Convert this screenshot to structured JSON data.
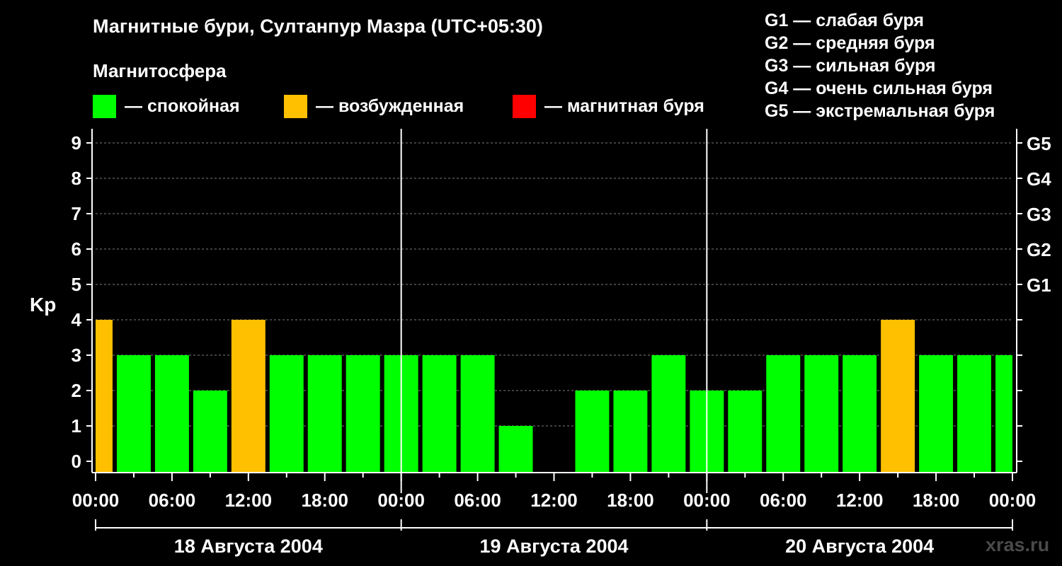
{
  "chart_data": {
    "type": "bar",
    "title": "Магнитные бури, Султанпур Мазра (UTC+05:30)",
    "subtitle": "Магнитосфера",
    "ylabel": "Kp",
    "ylim": [
      0,
      9
    ],
    "y_ticks": [
      "0",
      "1",
      "2",
      "3",
      "4",
      "5",
      "6",
      "7",
      "8",
      "9"
    ],
    "right_ticks": [
      {
        "value": 5,
        "label": "G1"
      },
      {
        "value": 6,
        "label": "G2"
      },
      {
        "value": 7,
        "label": "G3"
      },
      {
        "value": 8,
        "label": "G4"
      },
      {
        "value": 9,
        "label": "G5"
      }
    ],
    "x_tick_labels": [
      "00:00",
      "06:00",
      "12:00",
      "18:00",
      "00:00",
      "06:00",
      "12:00",
      "18:00",
      "00:00",
      "06:00",
      "12:00",
      "18:00",
      "00:00"
    ],
    "x_range_hours": [
      0,
      72
    ],
    "days": [
      "18 Августа 2004",
      "19 Августа 2004",
      "20 Августа 2004"
    ],
    "legend": [
      {
        "label": "— спокойная",
        "color": "#00ff00"
      },
      {
        "label": "— возбужденная",
        "color": "#ffc000"
      },
      {
        "label": "— магнитная буря",
        "color": "#ff0000"
      }
    ],
    "g_levels": [
      "G1 — слабая буря",
      "G2 — средняя буря",
      "G3 — сильная буря",
      "G4 — очень сильная буря",
      "G5 — экстремальная буря"
    ],
    "bars": [
      {
        "start": 0,
        "end": 1.5,
        "kp": 4,
        "state": "возбужденная"
      },
      {
        "start": 1.5,
        "end": 4.5,
        "kp": 3,
        "state": "спокойная"
      },
      {
        "start": 4.5,
        "end": 7.5,
        "kp": 3,
        "state": "спокойная"
      },
      {
        "start": 7.5,
        "end": 10.5,
        "kp": 2,
        "state": "спокойная"
      },
      {
        "start": 10.5,
        "end": 13.5,
        "kp": 4,
        "state": "возбужденная"
      },
      {
        "start": 13.5,
        "end": 16.5,
        "kp": 3,
        "state": "спокойная"
      },
      {
        "start": 16.5,
        "end": 19.5,
        "kp": 3,
        "state": "спокойная"
      },
      {
        "start": 19.5,
        "end": 22.5,
        "kp": 3,
        "state": "спокойная"
      },
      {
        "start": 22.5,
        "end": 25.5,
        "kp": 3,
        "state": "спокойная"
      },
      {
        "start": 25.5,
        "end": 28.5,
        "kp": 3,
        "state": "спокойная"
      },
      {
        "start": 28.5,
        "end": 31.5,
        "kp": 3,
        "state": "спокойная"
      },
      {
        "start": 31.5,
        "end": 34.5,
        "kp": 1,
        "state": "спокойная"
      },
      {
        "start": 34.5,
        "end": 37.5,
        "kp": 0,
        "state": "спокойная"
      },
      {
        "start": 37.5,
        "end": 40.5,
        "kp": 2,
        "state": "спокойная"
      },
      {
        "start": 40.5,
        "end": 43.5,
        "kp": 2,
        "state": "спокойная"
      },
      {
        "start": 43.5,
        "end": 46.5,
        "kp": 3,
        "state": "спокойная"
      },
      {
        "start": 46.5,
        "end": 49.5,
        "kp": 2,
        "state": "спокойная"
      },
      {
        "start": 49.5,
        "end": 52.5,
        "kp": 2,
        "state": "спокойная"
      },
      {
        "start": 52.5,
        "end": 55.5,
        "kp": 3,
        "state": "спокойная"
      },
      {
        "start": 55.5,
        "end": 58.5,
        "kp": 3,
        "state": "спокойная"
      },
      {
        "start": 58.5,
        "end": 61.5,
        "kp": 3,
        "state": "спокойная"
      },
      {
        "start": 61.5,
        "end": 64.5,
        "kp": 4,
        "state": "возбужденная"
      },
      {
        "start": 64.5,
        "end": 67.5,
        "kp": 3,
        "state": "спокойная"
      },
      {
        "start": 67.5,
        "end": 70.5,
        "kp": 3,
        "state": "спокойная"
      },
      {
        "start": 70.5,
        "end": 72,
        "kp": 3,
        "state": "спокойная"
      }
    ]
  },
  "colors": {
    "quiet": "#00ff00",
    "active": "#ffc000",
    "storm": "#ff0000",
    "background": "#000000",
    "grid": "#808080",
    "watermark": "#4a4a4a"
  },
  "watermark": "xras.ru"
}
